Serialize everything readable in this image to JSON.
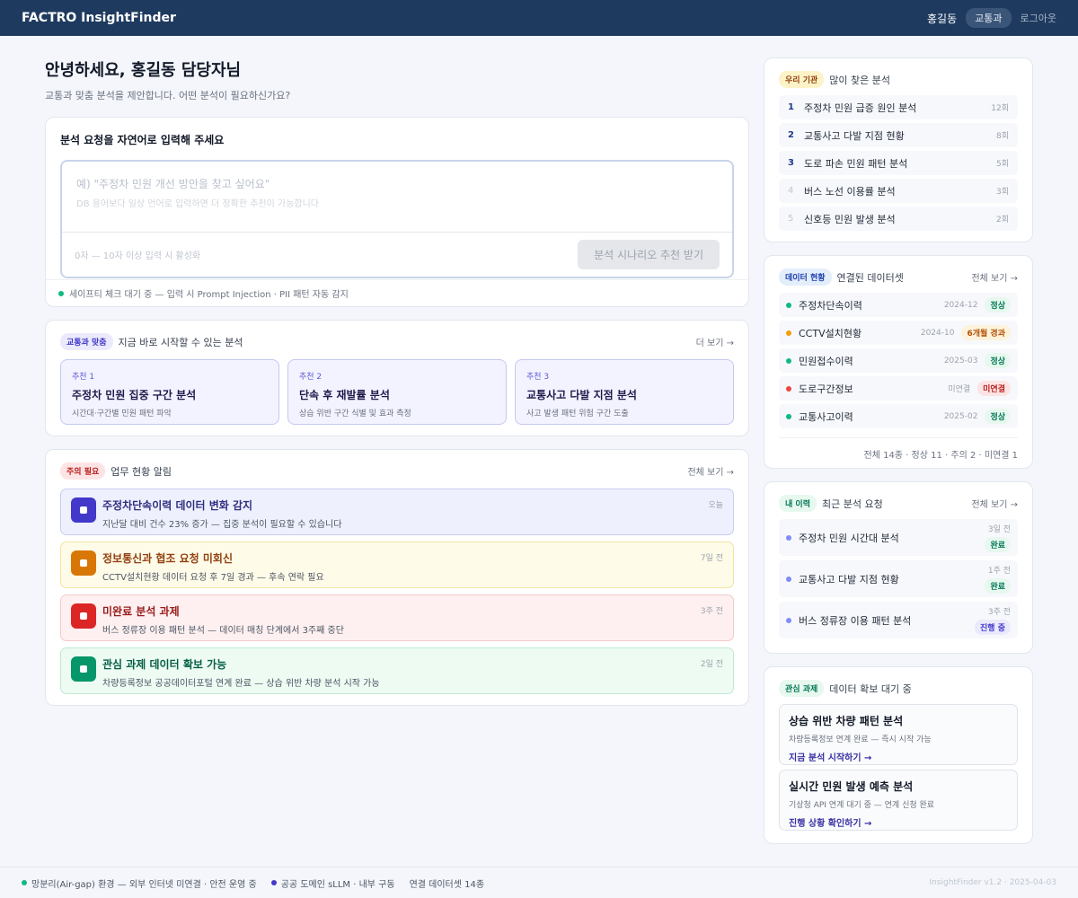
{
  "header": {
    "brand": "FACTRO InsightFinder",
    "user": "홍길동",
    "dept": "교통과",
    "logout": "로그아웃"
  },
  "main": {
    "greeting": "안녕하세요, 홍길동 담당자님",
    "greeting_sub": "교통과 맞춤 분석을 제안합니다. 어떤 분석이 필요하신가요?",
    "input": {
      "title": "분석 요청을 자연어로 입력해 주세요",
      "placeholder": "예) \"주정차 민원 개선 방안을 찾고 싶어요\"",
      "hint": "DB 용어보다 일상 언어로 입력하면 더 정확한 추천이 가능합니다",
      "char_count": "0자 — 10자 이상 입력 시 활성화",
      "submit_label": "분석 시나리오 추천 받기",
      "safety": "세이프티 체크 대기 중 — 입력 시 Prompt Injection · PII 패턴 자동 감지"
    },
    "recommend": {
      "pill": "교통과 맞춤",
      "title": "지금 바로 시작할 수 있는 분석",
      "more": "더 보기 →",
      "items": [
        {
          "label": "추천 1",
          "title": "주정차 민원 집중 구간 분석",
          "sub": "시간대·구간별 민원 패턴 파악"
        },
        {
          "label": "추천 2",
          "title": "단속 후 재발률 분석",
          "sub": "상습 위반 구간 식별 및 효과 측정"
        },
        {
          "label": "추천 3",
          "title": "교통사고 다발 지점 분석",
          "sub": "사고 발생 패턴 위험 구간 도출"
        }
      ]
    },
    "alerts": {
      "pill": "주의 필요",
      "title": "업무 현황 알림",
      "more": "전체 보기 →",
      "items": [
        {
          "title": "주정차단속이력 데이터 변화 감지",
          "desc": "지난달 대비 건수 23% 증가 — 집중 분석이 필요할 수 있습니다",
          "time": "오늘",
          "accent": "#4338ca",
          "bg": "#eef1fd",
          "border": "#c7cdf3",
          "title_color": "#312e81"
        },
        {
          "title": "정보통신과 협조 요청 미회신",
          "desc": "CCTV설치현황 데이터 요청 후 7일 경과 — 후속 연락 필요",
          "time": "7일 전",
          "accent": "#d97706",
          "bg": "#fefbe8",
          "border": "#f3e3a1",
          "title_color": "#92400e"
        },
        {
          "title": "미완료 분석 과제",
          "desc": "버스 정류장 이용 패턴 분석 — 데이터 매칭 단계에서 3주째 중단",
          "time": "3주 전",
          "accent": "#dc2626",
          "bg": "#fef0f0",
          "border": "#f5caca",
          "title_color": "#991b1b"
        },
        {
          "title": "관심 과제 데이터 확보 가능",
          "desc": "차량등록정보 공공데이터포털 연계 완료 — 상습 위반 차량 분석 시작 가능",
          "time": "2일 전",
          "accent": "#059669",
          "bg": "#edfbf3",
          "border": "#bfe9d2",
          "title_color": "#065f46"
        }
      ]
    }
  },
  "side": {
    "popular": {
      "pill": "우리 기관",
      "title": "많이 찾은 분석",
      "items": [
        {
          "rank": "1",
          "title": "주정차 민원 급증 원인 분석",
          "count": "12회"
        },
        {
          "rank": "2",
          "title": "교통사고 다발 지점 현황",
          "count": "8회"
        },
        {
          "rank": "3",
          "title": "도로 파손 민원 패턴 분석",
          "count": "5회"
        },
        {
          "rank": "4",
          "title": "버스 노선 이용률 분석",
          "count": "3회"
        },
        {
          "rank": "5",
          "title": "신호등 민원 발생 분석",
          "count": "2회"
        }
      ]
    },
    "datasets": {
      "pill": "데이터 현황",
      "title": "연결된 데이터셋",
      "more": "전체 보기 →",
      "items": [
        {
          "name": "주정차단속이력",
          "date": "2024-12",
          "status": "정상",
          "dot": "#10b981",
          "badge_bg": "#e7f8ef",
          "badge_fg": "#047857"
        },
        {
          "name": "CCTV설치현황",
          "date": "2024-10",
          "status": "6개월 경과",
          "dot": "#f59e0b",
          "badge_bg": "#fdf3dc",
          "badge_fg": "#b45309"
        },
        {
          "name": "민원접수이력",
          "date": "2025-03",
          "status": "정상",
          "dot": "#10b981",
          "badge_bg": "#e7f8ef",
          "badge_fg": "#047857"
        },
        {
          "name": "도로구간정보",
          "date": "미연결",
          "status": "미연결",
          "dot": "#ef4444",
          "badge_bg": "#fde4e4",
          "badge_fg": "#b91c1c"
        },
        {
          "name": "교통사고이력",
          "date": "2025-02",
          "status": "정상",
          "dot": "#10b981",
          "badge_bg": "#e7f8ef",
          "badge_fg": "#047857"
        }
      ],
      "summary": "전체 14종 · 정상 11 · 주의 2 · 미연결 1"
    },
    "history": {
      "pill": "내 이력",
      "title": "최근 분석 요청",
      "more": "전체 보기 →",
      "items": [
        {
          "title": "주정차 민원 시간대 분석",
          "time": "3일 전",
          "status": "완료",
          "badge_bg": "#e7f8ef",
          "badge_fg": "#047857"
        },
        {
          "title": "교통사고 다발 지점 현황",
          "time": "1주 전",
          "status": "완료",
          "badge_bg": "#e7f8ef",
          "badge_fg": "#047857"
        },
        {
          "title": "버스 정류장 이용 패턴 분석",
          "time": "3주 전",
          "status": "진행 중",
          "badge_bg": "#ebeafd",
          "badge_fg": "#4338ca"
        }
      ]
    },
    "interest": {
      "pill": "관심 과제",
      "title": "데이터 확보 대기 중",
      "items": [
        {
          "title": "상습 위반 차량 패턴 분석",
          "sub": "차량등록정보 연계 완료 — 즉시 시작 가능",
          "link": "지금 분석 시작하기 →"
        },
        {
          "title": "실시간 민원 발생 예측 분석",
          "sub": "기상청 API 연계 대기 중 — 연계 신청 완료",
          "link": "진행 상황 확인하기 →"
        }
      ]
    }
  },
  "footer": {
    "airgap": "망분리(Air-gap) 환경 — 외부 인터넷 미연결 · 안전 운영 중",
    "llm": "공공 도메인 sLLM · 내부 구동",
    "datasets": "연결 데이터셋 14종",
    "version": "InsightFinder v1.2 · 2025-04-03"
  },
  "colors": {
    "header_bg": "#1e3a5f",
    "accent": "#4338ca",
    "ok_green": "#10b981"
  }
}
